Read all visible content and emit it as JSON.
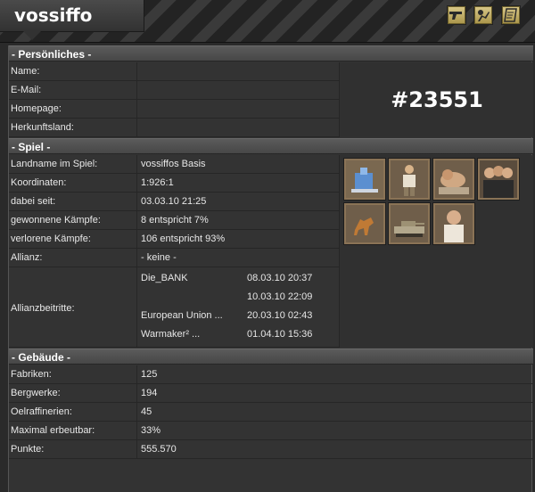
{
  "header": {
    "title": "vossiffo"
  },
  "sections": {
    "personal": "- Persönliches -",
    "game": "- Spiel -",
    "buildings": "- Gebäude -"
  },
  "personal": {
    "name_label": "Name:",
    "name_value": "",
    "email_label": "E-Mail:",
    "email_value": "",
    "homepage_label": "Homepage:",
    "homepage_value": "",
    "origin_label": "Herkunftsland:",
    "origin_value": "",
    "player_id": "#23551"
  },
  "game": {
    "landname_label": "Landname im Spiel:",
    "landname_value": "vossiffos Basis",
    "coords_label": "Koordinaten:",
    "coords_value": "1:926:1",
    "since_label": "dabei seit:",
    "since_value": "03.03.10 21:25",
    "won_label": "gewonnene Kämpfe:",
    "won_value": "8 entspricht 7%",
    "lost_label": "verlorene Kämpfe:",
    "lost_value": "106 entspricht 93%",
    "alliance_label": "Allianz:",
    "alliance_value": "- keine -",
    "joins_label": "Allianzbeitritte:",
    "joins": [
      {
        "name": "Die_BANK",
        "date": "08.03.10 20:37"
      },
      {
        "name": "",
        "date": "10.03.10 22:09"
      },
      {
        "name": "European Union ...",
        "date": "20.03.10 02:43"
      },
      {
        "name": "Warmaker² ...",
        "date": "01.04.10 15:36"
      }
    ]
  },
  "buildings": {
    "factories_label": "Fabriken:",
    "factories_value": "125",
    "mines_label": "Bergwerke:",
    "mines_value": "194",
    "refineries_label": "Oelraffinerien:",
    "refineries_value": "45",
    "max_label": "Maximal erbeutbar:",
    "max_value": "33%",
    "points_label": "Punkte:",
    "points_value": "555.570"
  },
  "icons": {
    "header_buttons": [
      "pistol-icon",
      "attack-icon",
      "notepad-icon"
    ],
    "units": [
      "base-building-icon",
      "soldier-icon",
      "sleeping-unit-icon",
      "group-unit-icon",
      "dog-unit-icon",
      "tank-unit-icon",
      "agent-unit-icon"
    ]
  }
}
